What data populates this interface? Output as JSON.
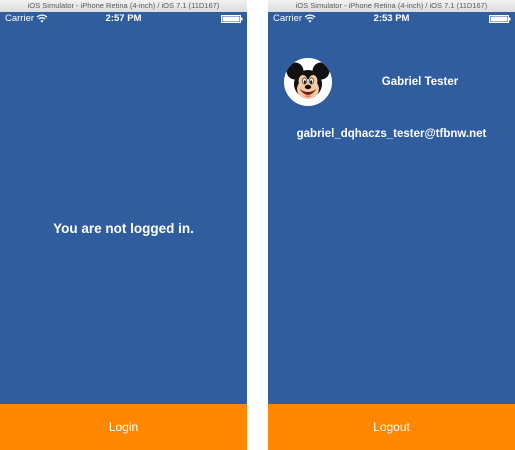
{
  "simulator": {
    "title": "iOS Simulator - iPhone Retina (4-inch) / iOS 7.1 (11D167)"
  },
  "colors": {
    "background": "#2f5d9d",
    "button": "#ff8800",
    "text": "#ffffff"
  },
  "screens": {
    "logged_out": {
      "status_bar": {
        "carrier": "Carrier",
        "time": "2:57 PM"
      },
      "message": "You are not logged in.",
      "button_label": "Login"
    },
    "logged_in": {
      "status_bar": {
        "carrier": "Carrier",
        "time": "2:53 PM"
      },
      "avatar_icon": "mickey-mouse-avatar",
      "name": "Gabriel Tester",
      "email": "gabriel_dqhaczs_tester@tfbnw.net",
      "button_label": "Logout"
    }
  }
}
